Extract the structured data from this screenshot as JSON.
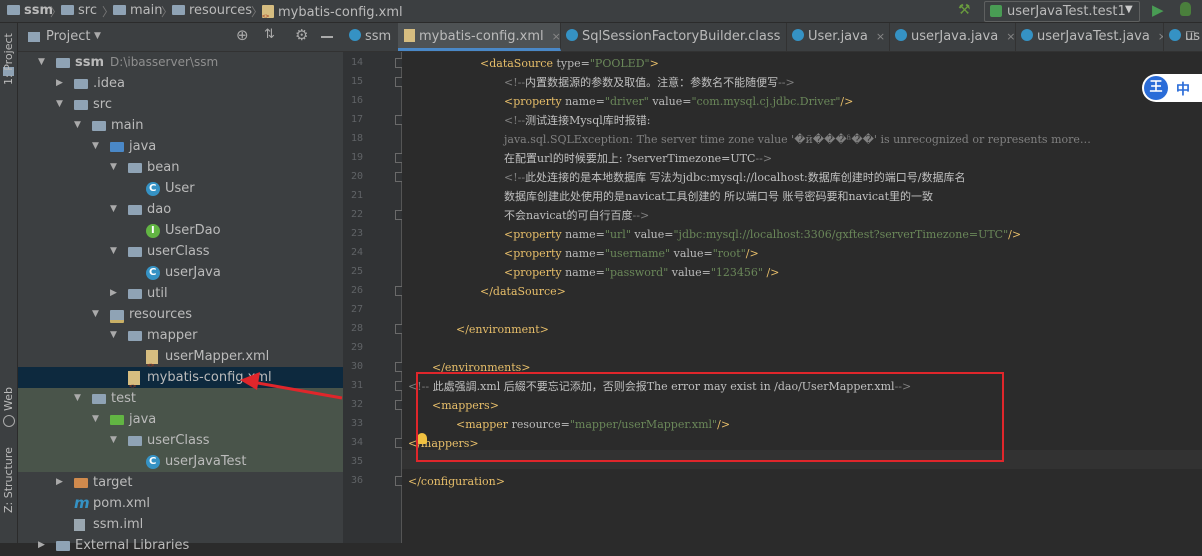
{
  "breadcrumb": [
    "ssm",
    "src",
    "main",
    "resources",
    "mybatis-config.xml"
  ],
  "run_config": "userJavaTest.test1",
  "left_strip": [
    "1: Project",
    "Web",
    "Z: Structure"
  ],
  "project_panel": {
    "title": "Project",
    "tree": [
      {
        "label": "ssm",
        "sub": "D:\\ibasserver\\ssm",
        "indent": 0,
        "open": true,
        "icon": "folder"
      },
      {
        "label": ".idea",
        "indent": 1,
        "open": false,
        "icon": "folder"
      },
      {
        "label": "src",
        "indent": 1,
        "open": true,
        "icon": "folder"
      },
      {
        "label": "main",
        "indent": 2,
        "open": true,
        "icon": "folder"
      },
      {
        "label": "java",
        "indent": 3,
        "open": true,
        "icon": "folder-blue"
      },
      {
        "label": "bean",
        "indent": 4,
        "open": true,
        "icon": "folder"
      },
      {
        "label": "User",
        "indent": 5,
        "icon": "class"
      },
      {
        "label": "dao",
        "indent": 4,
        "open": true,
        "icon": "folder"
      },
      {
        "label": "UserDao",
        "indent": 5,
        "icon": "interface"
      },
      {
        "label": "userClass",
        "indent": 4,
        "open": true,
        "icon": "folder"
      },
      {
        "label": "userJava",
        "indent": 5,
        "icon": "class"
      },
      {
        "label": "util",
        "indent": 4,
        "open": false,
        "icon": "folder"
      },
      {
        "label": "resources",
        "indent": 3,
        "open": true,
        "icon": "folder-res"
      },
      {
        "label": "mapper",
        "indent": 4,
        "open": true,
        "icon": "folder"
      },
      {
        "label": "userMapper.xml",
        "indent": 5,
        "icon": "xml"
      },
      {
        "label": "mybatis-config.xml",
        "indent": 4,
        "icon": "xml",
        "selected": true
      },
      {
        "label": "test",
        "indent": 2,
        "open": true,
        "icon": "folder",
        "highlight": true
      },
      {
        "label": "java",
        "indent": 3,
        "open": true,
        "icon": "folder-green",
        "highlight": true
      },
      {
        "label": "userClass",
        "indent": 4,
        "open": true,
        "icon": "folder",
        "highlight": true
      },
      {
        "label": "userJavaTest",
        "indent": 5,
        "icon": "class",
        "highlight": true
      },
      {
        "label": "target",
        "indent": 1,
        "open": false,
        "icon": "folder-orange"
      },
      {
        "label": "pom.xml",
        "indent": 1,
        "icon": "m"
      },
      {
        "label": "ssm.iml",
        "indent": 1,
        "icon": "iml"
      },
      {
        "label": "External Libraries",
        "indent": 0,
        "open": false,
        "icon": "lib"
      }
    ]
  },
  "tabs": [
    {
      "label": "ssm",
      "icon": "class",
      "active": false
    },
    {
      "label": "mybatis-config.xml",
      "icon": "xml",
      "active": true
    },
    {
      "label": "SqlSessionFactoryBuilder.class",
      "icon": "class",
      "active": false
    },
    {
      "label": "User.java",
      "icon": "class",
      "active": false
    },
    {
      "label": "userJava.java",
      "icon": "class",
      "active": false
    },
    {
      "label": "userJavaTest.java",
      "icon": "class",
      "active": false
    },
    {
      "label": "us",
      "icon": "class",
      "active": false
    }
  ],
  "ime": {
    "label": "中"
  },
  "code_lines": [
    {
      "n": "14",
      "segs": [
        [
          "tag",
          "<dataSource "
        ],
        [
          "attr",
          "type="
        ],
        [
          "val",
          "\"POOLED\""
        ],
        [
          "tag",
          ">"
        ]
      ],
      "indent": 6
    },
    {
      "n": "15",
      "segs": [
        [
          "cm",
          "<!--"
        ],
        [
          "cmcn",
          "内置数据源的参数及取值。注意：参数名不能随便写"
        ],
        [
          "cm",
          "-->"
        ]
      ],
      "indent": 8
    },
    {
      "n": "16",
      "segs": [
        [
          "tag",
          "<property "
        ],
        [
          "attr",
          "name="
        ],
        [
          "val",
          "\"driver\" "
        ],
        [
          "attr",
          "value="
        ],
        [
          "val",
          "\"com.mysql.cj.jdbc.Driver\""
        ],
        [
          "tag",
          "/>"
        ]
      ],
      "indent": 8
    },
    {
      "n": "17",
      "segs": [
        [
          "cm",
          "<!--"
        ],
        [
          "cmcn",
          "测试连接Mysql库时报错:"
        ]
      ],
      "indent": 8
    },
    {
      "n": "18",
      "segs": [
        [
          "cm",
          "java.sql.SQLException: The server time zone value '�й���ʱ��' is unrecognized or represents more…"
        ]
      ],
      "indent": 8
    },
    {
      "n": "19",
      "segs": [
        [
          "cmcn",
          "在配置url的时候要加上: ?serverTimezone=UTC"
        ],
        [
          "cm",
          "-->"
        ]
      ],
      "indent": 8
    },
    {
      "n": "20",
      "segs": [
        [
          "cm",
          "<!--"
        ],
        [
          "cmcn",
          "此处连接的是本地数据库 写法为jdbc:mysql://localhost:数据库创建时的端口号/数据库名"
        ]
      ],
      "indent": 8
    },
    {
      "n": "21",
      "segs": [
        [
          "cmcn",
          "数据库创建此处使用的是navicat工具创建的 所以端口号 账号密码要和navicat里的一致"
        ]
      ],
      "indent": 8
    },
    {
      "n": "22",
      "segs": [
        [
          "cmcn",
          "不会navicat的可自行百度"
        ],
        [
          "cm",
          "-->"
        ]
      ],
      "indent": 8
    },
    {
      "n": "23",
      "segs": [
        [
          "tag",
          "<property "
        ],
        [
          "attr",
          "name="
        ],
        [
          "val",
          "\"url\" "
        ],
        [
          "attr",
          "value="
        ],
        [
          "val",
          "\"jdbc:mysql://localhost:3306/gxftest?serverTimezone=UTC\""
        ],
        [
          "tag",
          "/>"
        ]
      ],
      "indent": 8
    },
    {
      "n": "24",
      "segs": [
        [
          "tag",
          "<property "
        ],
        [
          "attr",
          "name="
        ],
        [
          "val",
          "\"username\" "
        ],
        [
          "attr",
          "value="
        ],
        [
          "val",
          "\"root\""
        ],
        [
          "tag",
          "/>"
        ]
      ],
      "indent": 8
    },
    {
      "n": "25",
      "segs": [
        [
          "tag",
          "<property "
        ],
        [
          "attr",
          "name="
        ],
        [
          "val",
          "\"password\" "
        ],
        [
          "attr",
          "value="
        ],
        [
          "val",
          "\"123456\" "
        ],
        [
          "tag",
          "/>"
        ]
      ],
      "indent": 8
    },
    {
      "n": "26",
      "segs": [
        [
          "tag",
          "</dataSource>"
        ]
      ],
      "indent": 6
    },
    {
      "n": "27",
      "segs": [],
      "indent": 0
    },
    {
      "n": "28",
      "segs": [
        [
          "tag",
          "</environment>"
        ]
      ],
      "indent": 4
    },
    {
      "n": "29",
      "segs": [],
      "indent": 0
    },
    {
      "n": "30",
      "segs": [
        [
          "tag",
          "</environments>"
        ]
      ],
      "indent": 2
    },
    {
      "n": "31",
      "segs": [
        [
          "cm",
          "<!-- "
        ],
        [
          "cmcn",
          "此處强調.xml 后綴不要忘记添加，否则会报The error may exist in /dao/UserMapper.xml"
        ],
        [
          "cm",
          "-->"
        ]
      ],
      "indent": 0
    },
    {
      "n": "32",
      "segs": [
        [
          "tag",
          "<mappers>"
        ]
      ],
      "indent": 2
    },
    {
      "n": "33",
      "segs": [
        [
          "tag",
          "<mapper "
        ],
        [
          "attr",
          "resource="
        ],
        [
          "val",
          "\"mapper/userMapper.xml\""
        ],
        [
          "tag",
          "/>"
        ]
      ],
      "indent": 4
    },
    {
      "n": "34",
      "segs": [
        [
          "tag",
          "</mappers>"
        ]
      ],
      "indent": 0
    },
    {
      "n": "35",
      "segs": [],
      "indent": 0
    },
    {
      "n": "36",
      "segs": [
        [
          "tag",
          "</configuration>"
        ]
      ],
      "indent": 0
    }
  ]
}
